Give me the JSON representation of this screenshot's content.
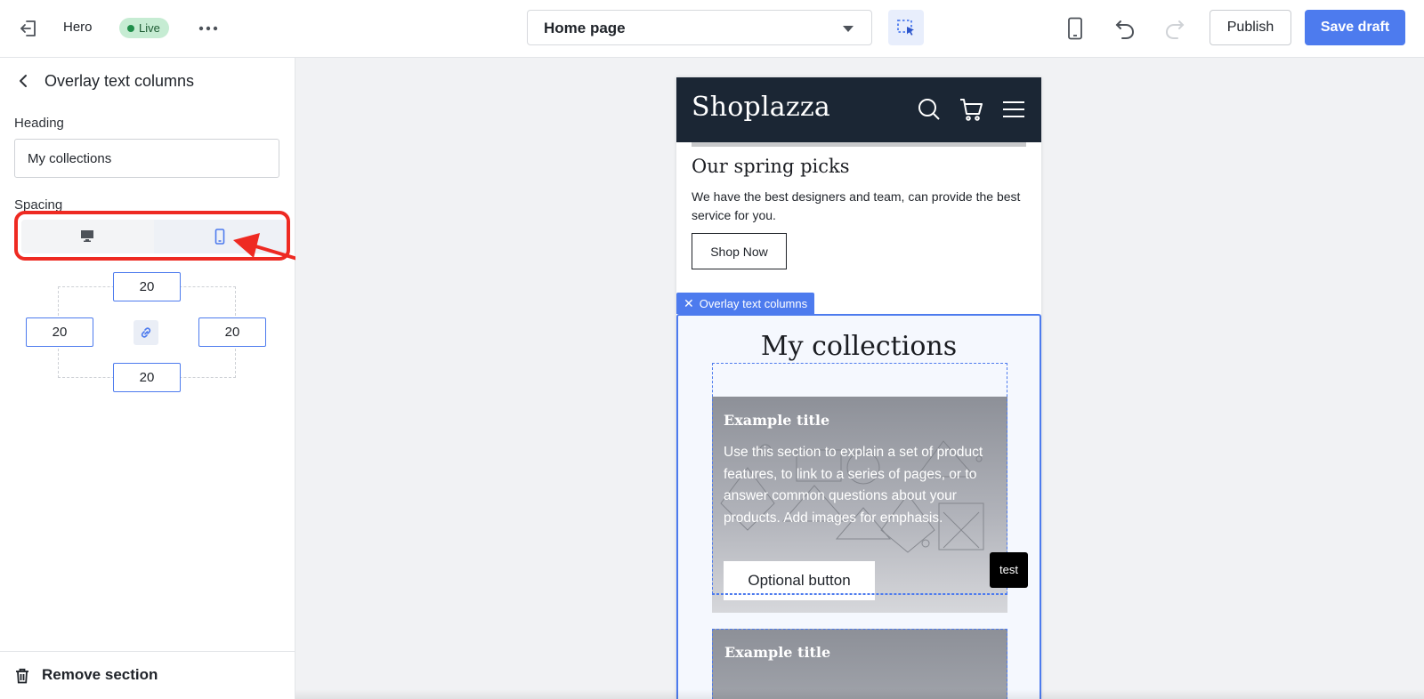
{
  "topbar": {
    "title": "Hero",
    "status_badge": "Live",
    "page_select_value": "Home page",
    "publish_label": "Publish",
    "save_draft_label": "Save draft",
    "accent_color": "#4d7bee",
    "live_color": "#1f8e4a"
  },
  "sidebar": {
    "title": "Overlay text columns",
    "heading_label": "Heading",
    "heading_value": "My collections",
    "spacing_label": "Spacing",
    "spacing_modes": [
      "desktop-icon",
      "mobile-icon"
    ],
    "spacing_active_mode": "mobile",
    "spacing": {
      "top": "20",
      "left": "20",
      "right": "20",
      "bottom": "20"
    },
    "remove_label": "Remove section",
    "annotation_color": "#ee2a22"
  },
  "preview": {
    "logo": "Shoplazza",
    "header_color": "#1b2634",
    "spring_title": "Our spring picks",
    "spring_desc": "We have the best designers and team, can provide the best service for you.",
    "shop_now": "Shop Now",
    "selected_tag": "Overlay text columns",
    "collections_title": "My collections",
    "card1": {
      "title": "Example title",
      "desc": "Use this section to explain a set of product features, to link to a series of pages, or to answer common questions about your products. Add images for emphasis.",
      "button": "Optional button"
    },
    "test_badge": "test",
    "card2": {
      "title": "Example title"
    }
  }
}
